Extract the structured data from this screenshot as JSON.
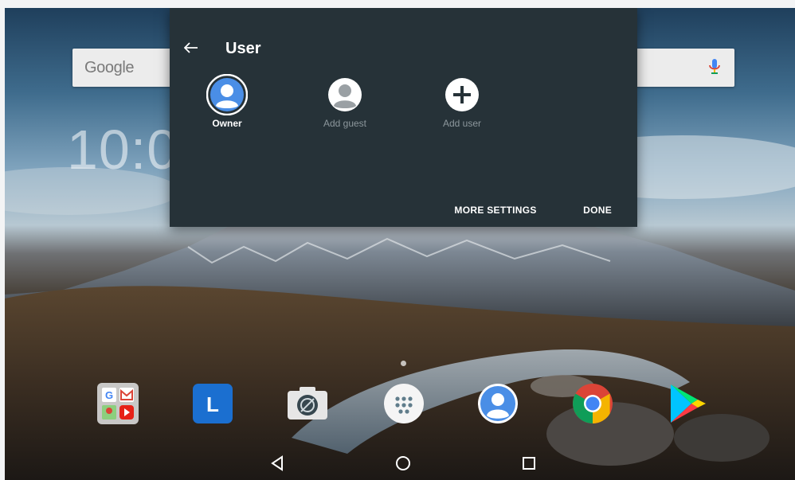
{
  "search": {
    "logo_text": "Google",
    "mic_icon": "mic-icon"
  },
  "clock": {
    "visible_text": "10:0"
  },
  "dialog": {
    "title": "User",
    "back_icon": "back-arrow-icon",
    "users": [
      {
        "label": "Owner",
        "icon": "owner-avatar-icon",
        "selected": true
      },
      {
        "label": "Add guest",
        "icon": "guest-avatar-icon",
        "selected": false
      },
      {
        "label": "Add user",
        "icon": "add-user-icon",
        "selected": false
      }
    ],
    "more_settings_label": "MORE SETTINGS",
    "done_label": "DONE"
  },
  "dock": {
    "apps": [
      {
        "icon": "google-apps-folder-icon"
      },
      {
        "icon": "lenovo-launcher-icon"
      },
      {
        "icon": "camera-icon"
      },
      {
        "icon": "app-drawer-icon"
      },
      {
        "icon": "contacts-icon"
      },
      {
        "icon": "chrome-icon"
      },
      {
        "icon": "play-store-icon"
      }
    ]
  },
  "navbar": {
    "buttons": [
      "back-icon",
      "home-icon",
      "recents-icon"
    ]
  },
  "colors": {
    "dialog_bg": "#263238",
    "accent_blue": "#4a8ee6",
    "dim_text": "#8c979c"
  }
}
